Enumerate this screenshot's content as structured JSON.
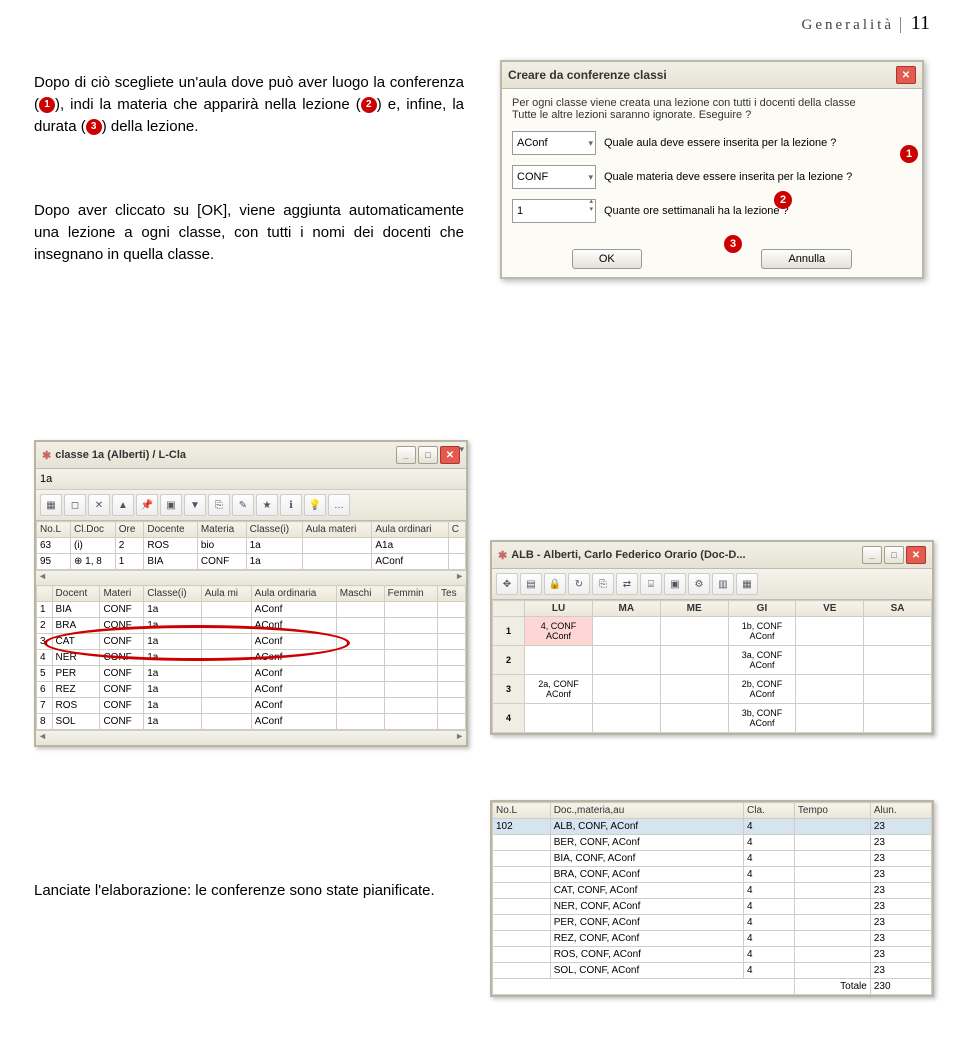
{
  "header": {
    "chapter": "Generalità",
    "page": "11"
  },
  "paragraphs": {
    "p1a": "Dopo di ciò scegliete un'aula dove può aver luogo la conferenza (",
    "p1b": "), indi la materia che apparirà nella lezione (",
    "p1c": ") e, infine, la durata (",
    "p1d": ") della lezione.",
    "p2": "Dopo aver cliccato su [OK], viene aggiunta automaticamente una lezione a ogni classe, con tutti i nomi dei docenti che insegnano in quella classe.",
    "bottom": "Lanciate l'elaborazione: le conferenze sono state pianificate."
  },
  "markers": {
    "m1": "1",
    "m2": "2",
    "m3": "3"
  },
  "dialog1": {
    "title": "Creare da conferenze classi",
    "info1": "Per ogni classe viene creata una lezione con tutti i docenti della classe",
    "info2": "Tutte le altre lezioni saranno ignorate. Eseguire ?",
    "aula_value": "AConf",
    "aula_label": "Quale aula deve essere inserita per la lezione ?",
    "materia_value": "CONF",
    "materia_label": "Quale materia deve essere inserita per la lezione ?",
    "ore_value": "1",
    "ore_label": "Quante ore settimanali ha la lezione ?",
    "ok": "OK",
    "cancel": "Annulla"
  },
  "win2": {
    "title": "classe 1a (Alberti) / L-Cla",
    "selector": "1a",
    "columns_top": [
      "No.L",
      "Cl.Doc",
      "Ore",
      "Docente",
      "Materia",
      "Classe(i)",
      "Aula materi",
      "Aula ordinari",
      "C"
    ],
    "rows_top": [
      [
        "63",
        "(i)",
        "2",
        "ROS",
        "bio",
        "1a",
        "",
        "A1a",
        ""
      ],
      [
        "95",
        "⊕ 1, 8",
        "1",
        "BIA",
        "CONF",
        "1a",
        "",
        "AConf",
        ""
      ]
    ],
    "columns_bot": [
      "",
      "Docent",
      "Materi",
      "Classe(i)",
      "Aula mi",
      "Aula ordinaria",
      "Maschi",
      "Femmin",
      "Tes"
    ],
    "rows_bot": [
      [
        "1",
        "BIA",
        "CONF",
        "1a",
        "",
        "AConf",
        "",
        "",
        ""
      ],
      [
        "2",
        "BRA",
        "CONF",
        "1a",
        "",
        "AConf",
        "",
        "",
        ""
      ],
      [
        "3",
        "CAT",
        "CONF",
        "1a",
        "",
        "AConf",
        "",
        "",
        ""
      ],
      [
        "4",
        "NER",
        "CONF",
        "1a",
        "",
        "AConf",
        "",
        "",
        ""
      ],
      [
        "5",
        "PER",
        "CONF",
        "1a",
        "",
        "AConf",
        "",
        "",
        ""
      ],
      [
        "6",
        "REZ",
        "CONF",
        "1a",
        "",
        "AConf",
        "",
        "",
        ""
      ],
      [
        "7",
        "ROS",
        "CONF",
        "1a",
        "",
        "AConf",
        "",
        "",
        ""
      ],
      [
        "8",
        "SOL",
        "CONF",
        "1a",
        "",
        "AConf",
        "",
        "",
        ""
      ]
    ]
  },
  "win3": {
    "title": "ALB - Alberti, Carlo Federico  Orario  (Doc-D...",
    "days": [
      "LU",
      "MA",
      "ME",
      "GI",
      "VE",
      "SA"
    ],
    "rows": [
      {
        "n": "1",
        "cells": [
          "4, CONF\nAConf",
          "",
          "",
          "1b, CONF\nAConf",
          "",
          ""
        ],
        "hl": 0
      },
      {
        "n": "2",
        "cells": [
          "",
          "",
          "",
          "3a, CONF\nAConf",
          "",
          ""
        ]
      },
      {
        "n": "3",
        "cells": [
          "2a, CONF\nAConf",
          "",
          "",
          "2b, CONF\nAConf",
          "",
          ""
        ]
      },
      {
        "n": "4",
        "cells": [
          "",
          "",
          "",
          "3b, CONF\nAConf",
          "",
          ""
        ]
      }
    ]
  },
  "win4": {
    "columns": [
      "No.L",
      "Doc.,materia,au",
      "Cla.",
      "Tempo",
      "Alun."
    ],
    "rows": [
      [
        "102",
        "ALB, CONF, AConf",
        "4",
        "",
        "23"
      ],
      [
        "",
        "BER, CONF, AConf",
        "4",
        "",
        "23"
      ],
      [
        "",
        "BIA, CONF, AConf",
        "4",
        "",
        "23"
      ],
      [
        "",
        "BRA, CONF, AConf",
        "4",
        "",
        "23"
      ],
      [
        "",
        "CAT, CONF, AConf",
        "4",
        "",
        "23"
      ],
      [
        "",
        "NER, CONF, AConf",
        "4",
        "",
        "23"
      ],
      [
        "",
        "PER, CONF, AConf",
        "4",
        "",
        "23"
      ],
      [
        "",
        "REZ, CONF, AConf",
        "4",
        "",
        "23"
      ],
      [
        "",
        "ROS, CONF, AConf",
        "4",
        "",
        "23"
      ],
      [
        "",
        "SOL, CONF, AConf",
        "4",
        "",
        "23"
      ]
    ],
    "totale_label": "Totale",
    "totale_value": "230"
  }
}
